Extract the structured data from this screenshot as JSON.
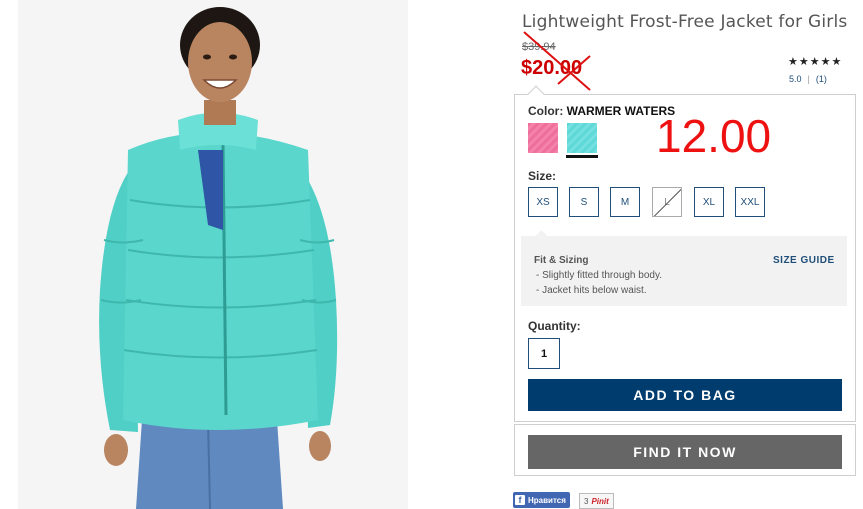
{
  "product": {
    "title": "Lightweight Frost-Free Jacket for Girls",
    "old_price": "$39.94",
    "sale_price": "$20.00",
    "stars": "★★★★★",
    "rating": "5.0",
    "review_count": "(1)"
  },
  "color": {
    "label": "Color:",
    "value": "WARMER WATERS",
    "swatches": [
      {
        "name": "pink",
        "hex": "#ef6f9c"
      },
      {
        "name": "aqua",
        "hex": "#5fd8d8",
        "selected": true
      }
    ]
  },
  "overlay_number": "12.00",
  "size": {
    "label": "Size:",
    "options": [
      "XS",
      "S",
      "M",
      "L",
      "XL",
      "XXL"
    ],
    "unavailable": [
      "L"
    ]
  },
  "fit": {
    "title": "Fit & Sizing",
    "guide_link": "SIZE GUIDE",
    "lines": [
      "- Slightly fitted through body.",
      "- Jacket hits below waist."
    ]
  },
  "quantity": {
    "label": "Quantity:",
    "value": "1"
  },
  "buttons": {
    "add_to_bag": "ADD TO BAG",
    "find_it_now": "FIND IT NOW"
  },
  "social": {
    "fb_like": "Нравится",
    "pin_count": "3",
    "pin_label": "Pinit"
  },
  "colors": {
    "accent_navy": "#003c6e",
    "sale_red": "#cc0000",
    "find_gray": "#666666"
  }
}
